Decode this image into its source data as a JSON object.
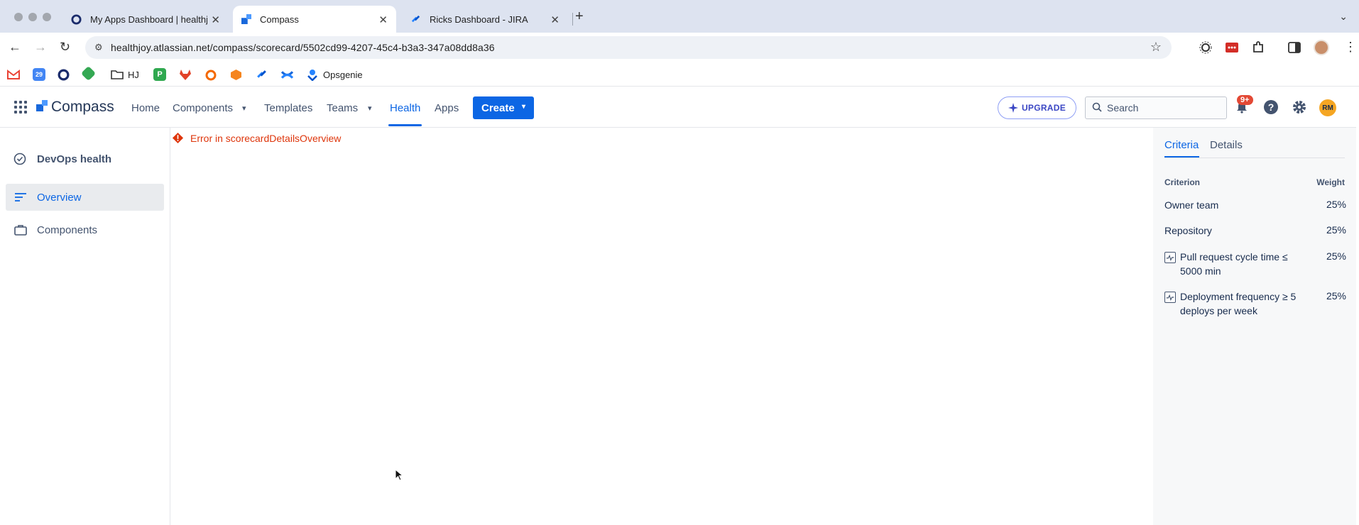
{
  "browser": {
    "tabs": [
      {
        "title": "My Apps Dashboard | healthjoy",
        "active": false
      },
      {
        "title": "Compass",
        "active": true
      },
      {
        "title": "Ricks Dashboard - JIRA",
        "active": false
      }
    ],
    "url": "healthjoy.atlassian.net/compass/scorecard/5502cd99-4207-45c4-b3a3-347a08dd8a36",
    "bookmarks": [
      {
        "label": "HJ"
      },
      {
        "label": "Opsgenie"
      }
    ]
  },
  "app": {
    "logo_text": "Compass",
    "nav": [
      {
        "label": "Home"
      },
      {
        "label": "Components"
      },
      {
        "label": "Templates"
      },
      {
        "label": "Teams"
      },
      {
        "label": "Health",
        "active": true
      },
      {
        "label": "Apps"
      }
    ],
    "create_label": "Create",
    "upgrade_label": "UPGRADE",
    "search_placeholder": "Search",
    "notification_badge": "9+",
    "avatar_initials": "RM"
  },
  "sidebar": {
    "title": "DevOps health",
    "items": [
      {
        "label": "Overview",
        "selected": true
      },
      {
        "label": "Components",
        "selected": false
      }
    ]
  },
  "main": {
    "error_text": "Error in scorecardDetailsOverview"
  },
  "right_panel": {
    "tabs": [
      {
        "label": "Criteria",
        "active": true
      },
      {
        "label": "Details",
        "active": false
      }
    ],
    "criterion_header": "Criterion",
    "weight_header": "Weight",
    "criteria": [
      {
        "name": "Owner team",
        "weight": "25%",
        "metric": false
      },
      {
        "name": "Repository",
        "weight": "25%",
        "metric": false
      },
      {
        "name": "Pull request cycle time ≤ 5000 min",
        "weight": "25%",
        "metric": true
      },
      {
        "name": "Deployment frequency ≥ 5 deploys per week",
        "weight": "25%",
        "metric": true
      }
    ]
  },
  "colors": {
    "accent": "#0c66e4",
    "error": "#de350b",
    "badge": "#e34935",
    "avatar": "#f5a623"
  }
}
